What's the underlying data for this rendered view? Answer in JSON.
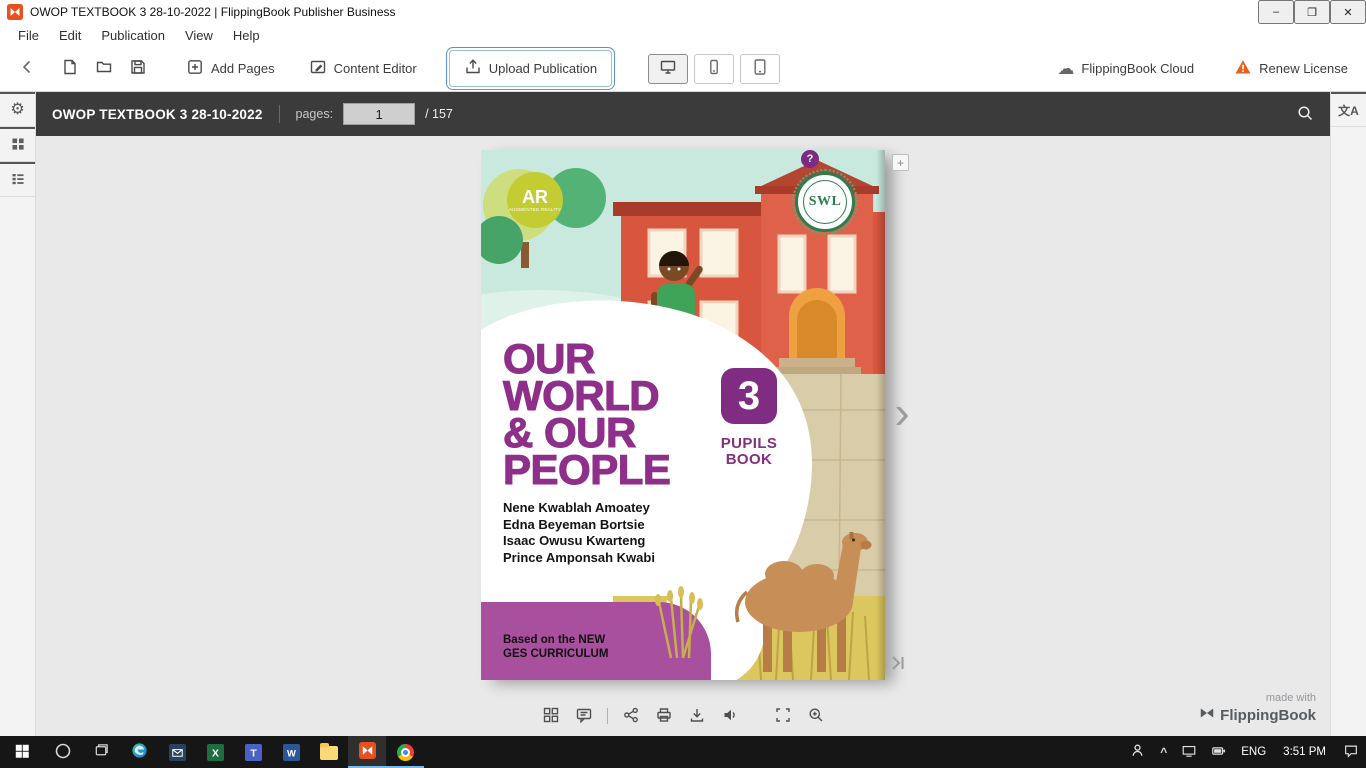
{
  "colors": {
    "title_purple": "#8e2f8a",
    "band_magenta": "#a84f9e",
    "focus_blue": "#5795d0",
    "warning_orange": "#e8611c",
    "header_dark": "#3b3b3b",
    "taskbar_accent": "#76b9ed"
  },
  "titlebar": {
    "title": "OWOP TEXTBOOK 3 28-10-2022 | FlippingBook Publisher Business",
    "minimize": "–",
    "maximize": "❐",
    "close": "✕"
  },
  "menubar": {
    "items": [
      "File",
      "Edit",
      "Publication",
      "View",
      "Help"
    ]
  },
  "toolbar": {
    "add_pages": "Add Pages",
    "content_editor": "Content Editor",
    "upload_publication": "Upload Publication",
    "flippingbook_cloud": "FlippingBook Cloud",
    "renew_license": "Renew License"
  },
  "pub_header": {
    "title": "OWOP TEXTBOOK 3 28-10-2022",
    "pages_label": "pages:",
    "current_page": "1",
    "total_pages": "/ 157"
  },
  "cover": {
    "help_badge": "?",
    "ar_title": "AR",
    "ar_subtitle": "AUGMENTED REALITY",
    "swl_label": "SWL",
    "title_lines": [
      "OUR",
      "WORLD",
      "& OUR",
      "PEOPLE"
    ],
    "grade_number": "3",
    "book_type_lines": [
      "PUPILS",
      "BOOK"
    ],
    "authors": [
      "Nene Kwablah Amoatey",
      "Edna Beyeman Bortsie",
      "Isaac Owusu Kwarteng",
      "Prince Amponsah Kwabi"
    ],
    "footer_lines": [
      "Based on the NEW",
      "GES CURRICULUM"
    ]
  },
  "viewer": {
    "made_with": "made with",
    "brand": "FlippingBook"
  },
  "icons": {
    "cloud": "☁",
    "gear": "⚙",
    "translate": "文A",
    "bookmark_plus": "+",
    "next_chevron": "›",
    "tray_chevron": "^"
  },
  "taskbar": {
    "language": "ENG",
    "time": "3:51 PM"
  }
}
